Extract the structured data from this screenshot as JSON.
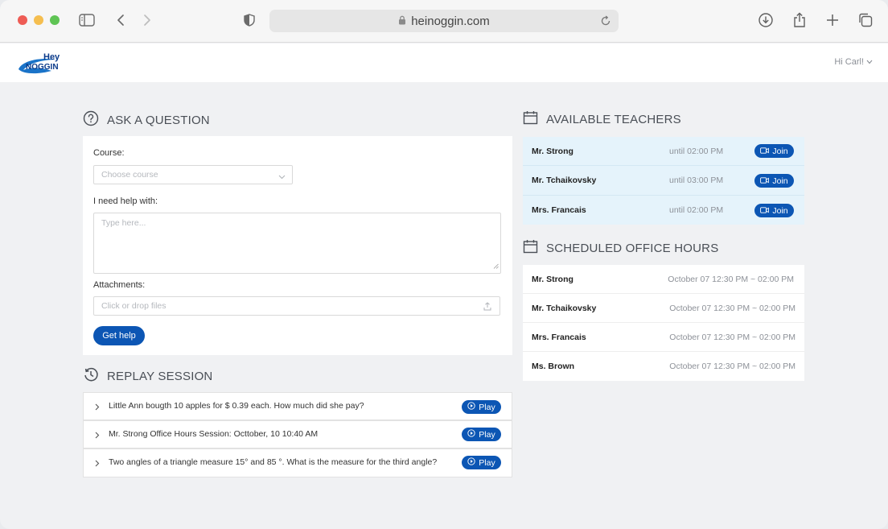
{
  "browser": {
    "url": "heinoggin.com"
  },
  "header": {
    "logo_top": "Hey",
    "logo_bottom": "NOGGIN",
    "user_greeting": "Hi Carl!"
  },
  "ask": {
    "title": "ASK A QUESTION",
    "course_label": "Course:",
    "course_placeholder": "Choose course",
    "help_label": "I need help with:",
    "help_placeholder": "Type here...",
    "attachments_label": "Attachments:",
    "attachments_placeholder": "Click or drop files",
    "submit_label": "Get help"
  },
  "replay": {
    "title": "REPLAY SESSION",
    "play_label": "Play",
    "items": [
      {
        "text": "Little Ann bougth 10 apples for $ 0.39 each. How much did she pay?"
      },
      {
        "text": "Mr. Strong Office Hours Session: Octtober, 10 10:40 AM"
      },
      {
        "text": "Two angles of a triangle measure 15° and 85 °. What is the measure for the third angle?"
      }
    ]
  },
  "teachers": {
    "title": "AVAILABLE TEACHERS",
    "join_label": "Join",
    "items": [
      {
        "name": "Mr. Strong",
        "until": "until 02:00 PM"
      },
      {
        "name": "Mr. Tchaikovsky",
        "until": "until 03:00 PM"
      },
      {
        "name": "Mrs. Francais",
        "until": "until 02:00 PM"
      }
    ]
  },
  "office": {
    "title": "SCHEDULED OFFICE HOURS",
    "items": [
      {
        "name": "Mr. Strong",
        "time": "October 07 12:30 PM ~ 02:00 PM"
      },
      {
        "name": "Mr. Tchaikovsky",
        "time": "October 07 12:30 PM ~ 02:00 PM"
      },
      {
        "name": "Mrs. Francais",
        "time": "October 07 12:30 PM ~ 02:00 PM"
      },
      {
        "name": "Ms. Brown",
        "time": "October 07 12:30 PM ~ 02:00 PM"
      }
    ]
  },
  "colors": {
    "primary": "#0c56b4",
    "teacher_row_bg": "#e5f3fb",
    "page_bg": "#f0f1f3"
  }
}
